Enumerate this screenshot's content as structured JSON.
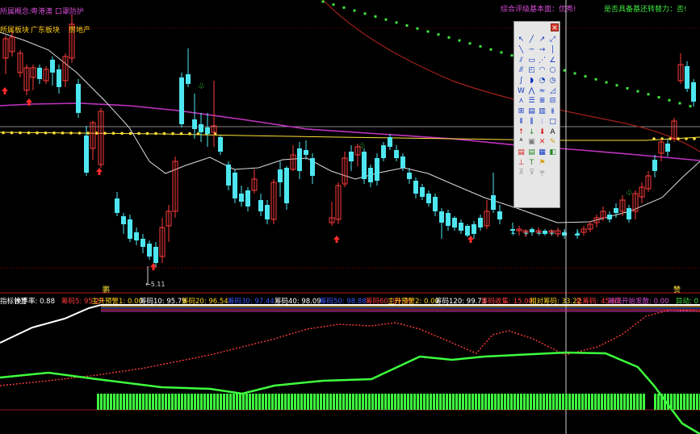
{
  "header_left": [
    {
      "text": "所属概念:",
      "color": "#d24bd2"
    },
    {
      "text": "粤港澳 口罩防护",
      "color": "#d24bd2"
    }
  ],
  "header_row2": [
    {
      "text": "所属板块",
      "color": "#ffd21a"
    },
    {
      "text": "广东板块",
      "color": "#ffd21a"
    },
    {
      "text": "房地产",
      "color": "#ffd21a"
    }
  ],
  "header_right": [
    {
      "text": "综合评级基本面：优秀!",
      "color": "#d24bd2"
    },
    {
      "text": "是否具备基还转替力：否!",
      "color": "#3ee63e"
    }
  ],
  "price_labels": {
    "low_marker": "←5.11"
  },
  "signal_marks": {
    "left": "鹏",
    "right": "赞"
  },
  "indicator_legend": [
    {
      "text": "指标计算",
      "color": "#ffffff"
    },
    {
      "text": "换手率: 0.88",
      "color": "#ffffff"
    },
    {
      "text": "筹码5: 95.27",
      "color": "#ff3b3b"
    },
    {
      "text": "主升预警1: 0.00",
      "color": "#ffd21a"
    },
    {
      "text": "筹码10: 95.79",
      "color": "#ffffff"
    },
    {
      "text": "筹码20: 96.54",
      "color": "#ffd21a"
    },
    {
      "text": "筹码30: 97.44",
      "color": "#3a56ff"
    },
    {
      "text": "筹码40: 98.09",
      "color": "#ffffff"
    },
    {
      "text": "筹码50: 98.88",
      "color": "#3a56ff"
    },
    {
      "text": "筹码60: 99.30",
      "color": "#ff3b3b"
    },
    {
      "text": "主升预警2: 0.00",
      "color": "#ffd21a"
    },
    {
      "text": "筹码120: 99.73",
      "color": "#ffffff"
    },
    {
      "text": "筹码收集: 15.00",
      "color": "#ff3b3b"
    },
    {
      "text": "相对筹码: 33.22",
      "color": "#ffd21a"
    },
    {
      "text": "总筹码: 45.63",
      "color": "#ff3b3b"
    },
    {
      "text": "筹码开始发散: 0.00",
      "color": "#d24bd2"
    },
    {
      "text": "异动: 0",
      "color": "#3ee63e"
    }
  ],
  "colors": {
    "bull": "#ff3b3b",
    "bear": "#4ee6f0",
    "ma_white": "#dcdcdc",
    "ma_magenta": "#c234c2",
    "ma_darkred": "#a0201a",
    "ma_yellow": "#ffe23a",
    "ma_green_dotted": "#3ee63e",
    "volume_green": "#3eff3e"
  },
  "toolbox": {
    "close_label": "×",
    "tools": [
      {
        "name": "pointer-tool-icon",
        "glyph": "↖",
        "color": "#0b35c4"
      },
      {
        "name": "line-tool-icon",
        "glyph": "╱",
        "color": "#0b35c4"
      },
      {
        "name": "ray-tool-icon",
        "glyph": "↗",
        "color": "#0b35c4"
      },
      {
        "name": "extend-line-icon",
        "glyph": "⤢",
        "color": "#0b35c4"
      },
      {
        "name": "segment-tool-icon",
        "glyph": "╲",
        "color": "#0b35c4"
      },
      {
        "name": "hline-tool-icon",
        "glyph": "─",
        "color": "#0b35c4"
      },
      {
        "name": "arrow-line-icon",
        "glyph": "→",
        "color": "#0b35c4"
      },
      {
        "name": "vline-tool-icon",
        "glyph": "│",
        "color": "#0b35c4"
      },
      {
        "name": "parallel-tool-icon",
        "glyph": "⫽",
        "color": "#0b35c4"
      },
      {
        "name": "channel-tool-icon",
        "glyph": "▭",
        "color": "#0b35c4"
      },
      {
        "name": "fan-tool-icon",
        "glyph": "⋰",
        "color": "#0b35c4"
      },
      {
        "name": "angle-tool-icon",
        "glyph": "∠",
        "color": "#0b35c4"
      },
      {
        "name": "multi-line-icon",
        "glyph": "⫻",
        "color": "#0b35c4"
      },
      {
        "name": "rectangle-tool-icon",
        "glyph": "◰",
        "color": "#0b35c4"
      },
      {
        "name": "arc-tool-icon",
        "glyph": "◠",
        "color": "#0b35c4"
      },
      {
        "name": "circle-tool-icon",
        "glyph": "○",
        "color": "#0b35c4"
      },
      {
        "name": "curve-tool-icon",
        "glyph": "∫",
        "color": "#0b35c4"
      },
      {
        "name": "half-circle-icon",
        "glyph": "◗",
        "color": "#0b35c4"
      },
      {
        "name": "cycle-tool-icon",
        "glyph": "◔",
        "color": "#0b35c4"
      },
      {
        "name": "clock-tool-icon",
        "glyph": "◷",
        "color": "#0b35c4"
      },
      {
        "name": "wave-tool-icon",
        "glyph": "W",
        "color": "#0b35c4"
      },
      {
        "name": "zigzag-tool-icon",
        "glyph": "⋀",
        "color": "#0b35c4"
      },
      {
        "name": "wave-mini-icon",
        "glyph": "≈",
        "color": "#0b35c4"
      },
      {
        "name": "triangle-tool-icon",
        "glyph": "◿",
        "color": "#0b35c4"
      },
      {
        "name": "peak-tool-icon",
        "glyph": "⋏",
        "color": "#0b35c4"
      },
      {
        "name": "fib-retrace-icon",
        "glyph": "☰",
        "color": "#0b35c4"
      },
      {
        "name": "fib-fan-icon",
        "glyph": "≣",
        "color": "#0b35c4"
      },
      {
        "name": "fib-zone-icon",
        "glyph": "⊟",
        "color": "#0b35c4"
      },
      {
        "name": "gann-box-icon",
        "glyph": "⊞",
        "color": "#0b35c4"
      },
      {
        "name": "gann-grid-icon",
        "glyph": "▤",
        "color": "#0b35c4"
      },
      {
        "name": "gann-fan-icon",
        "glyph": "▥",
        "color": "#0b35c4"
      },
      {
        "name": "speed-line-icon",
        "glyph": "⫵",
        "color": "#0b35c4"
      },
      {
        "name": "period-line-icon",
        "glyph": "⦀",
        "color": "#0b35c4"
      },
      {
        "name": "time-zone-icon",
        "glyph": "⫼",
        "color": "#0b35c4"
      },
      {
        "name": "fib-time-icon",
        "glyph": "⦙",
        "color": "#0b35c4"
      },
      {
        "name": "square-tool-icon",
        "glyph": "□",
        "color": "#0b35c4"
      },
      {
        "name": "arrow-up-icon",
        "glyph": "↑",
        "color": "#d81b1b"
      },
      {
        "name": "arrow-down-icon",
        "glyph": "↓",
        "color": "#2a8a2a"
      },
      {
        "name": "arrow-down-red-icon",
        "glyph": "⬇",
        "color": "#d81b1b"
      },
      {
        "name": "text-tool-icon",
        "glyph": "A",
        "color": "#111111"
      },
      {
        "name": "text-box-icon",
        "glyph": "ᴬ",
        "color": "#111111"
      },
      {
        "name": "sticker-icon",
        "glyph": "▣",
        "color": "#777777"
      },
      {
        "name": "delete-tool-icon",
        "glyph": "✕",
        "color": "#d81b1b"
      },
      {
        "name": "brush-tool-icon",
        "glyph": "✎",
        "color": "#c8a21a"
      },
      {
        "name": "buy-mark-icon",
        "glyph": "▤",
        "color": "#d81b1b"
      },
      {
        "name": "sell-mark-icon",
        "glyph": "▤",
        "color": "#2a8a2a"
      },
      {
        "name": "note-tool-icon",
        "glyph": "▦",
        "color": "#0b35c4"
      },
      {
        "name": "save-tool-icon",
        "glyph": "◧",
        "color": "#2a8a2a"
      },
      {
        "name": "up-tag-icon",
        "glyph": "⊥",
        "color": "#d81b1b"
      },
      {
        "name": "down-tag-icon",
        "glyph": "T",
        "color": "#2a8a2a"
      },
      {
        "name": "flag-tool-icon",
        "glyph": "⚑",
        "color": "#d8a21a"
      },
      {
        "name": "blank-tool-icon",
        "glyph": " ",
        "color": "#0b35c4"
      },
      {
        "name": "gray-tag-1-icon",
        "glyph": "⊼",
        "color": "#999999"
      },
      {
        "name": "gray-tag-2-icon",
        "glyph": "⊽",
        "color": "#999999"
      },
      {
        "name": "gray-tag-3-icon",
        "glyph": "╤",
        "color": "#999999"
      },
      {
        "name": "gray-blank-icon",
        "glyph": " ",
        "color": "#999999"
      }
    ]
  }
}
